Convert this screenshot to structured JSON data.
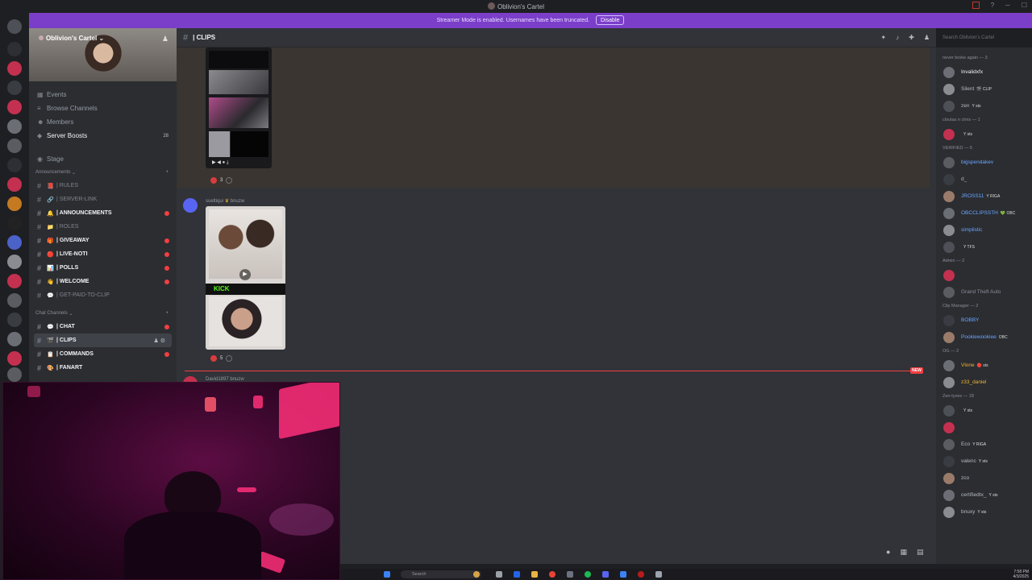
{
  "window": {
    "title": "Oblivion's Cartel"
  },
  "banner": {
    "text": "Streamer Mode is enabled. Usernames have been truncated.",
    "disable_label": "Disable"
  },
  "sidebar": {
    "server_name": "Oblivion's Cartel",
    "nav": [
      {
        "label": "Events",
        "icon": "calendar-icon"
      },
      {
        "label": "Browse Channels",
        "icon": "browse-icon"
      },
      {
        "label": "Members",
        "icon": "members-icon"
      },
      {
        "label": "Server Boosts",
        "icon": "boost-icon",
        "count": "28"
      },
      {
        "label": "Stage",
        "icon": "stage-icon"
      }
    ],
    "categories": [
      {
        "name": "Announcements",
        "channels": [
          {
            "label": "| RULES",
            "emoji": "📕",
            "unread": false
          },
          {
            "label": "| SERVER-LINK",
            "emoji": "🔗",
            "unread": false
          },
          {
            "label": "| ANNOUNCEMENTS",
            "emoji": "🔔",
            "unread": true
          },
          {
            "label": "| ROLES",
            "emoji": "📁",
            "unread": false
          },
          {
            "label": "| GIVEAWAY",
            "emoji": "🎁",
            "unread": true
          },
          {
            "label": "| LIVE-NOTI",
            "emoji": "🔴",
            "unread": true
          },
          {
            "label": "| POLLS",
            "emoji": "📊",
            "unread": true
          },
          {
            "label": "| WELCOME",
            "emoji": "👋",
            "unread": true
          },
          {
            "label": "| GET-PAID-TO-CLIP",
            "emoji": "💬",
            "unread": false
          }
        ]
      },
      {
        "name": "Chat Channels",
        "channels": [
          {
            "label": "| CHAT",
            "emoji": "💬",
            "unread": true
          },
          {
            "label": "| CLIPS",
            "emoji": "🎬",
            "unread": true,
            "active": true
          },
          {
            "label": "| COMMANDS",
            "emoji": "📋",
            "unread": true
          },
          {
            "label": "| FANART",
            "emoji": "🎨",
            "unread": true
          }
        ]
      }
    ]
  },
  "header": {
    "channel": "| CLIPS",
    "search_placeholder": "Search Oblivion's Cartel"
  },
  "messages": [
    {
      "reaction_count": "3"
    },
    {
      "author": "sueltiqui",
      "tag": "bnuzw",
      "reaction_count": "5",
      "kick_label": "KICK"
    },
    {
      "author": "David1897",
      "tag": "bnuzw"
    }
  ],
  "new_marker": "NEW",
  "members": {
    "groups": [
      {
        "name": "never broke again — 3",
        "items": [
          {
            "name": "Invalidxfx",
            "color": "#f2f3f5",
            "tag": ""
          },
          {
            "name": "Silent",
            "color": "#b5bac1",
            "tag": "🎬 CLIP"
          },
          {
            "name": "zen",
            "color": "#b5bac1",
            "tag": "Y sts"
          }
        ]
      },
      {
        "name": "cloutas n chris — 1",
        "items": [
          {
            "name": "",
            "color": "#b5bac1",
            "tag": "Y sts"
          }
        ]
      },
      {
        "name": "VERIFIED — 5",
        "items": [
          {
            "name": "bigspendakev",
            "color": "#6aa5ff",
            "tag": ""
          },
          {
            "name": "d_",
            "color": "#b5bac1",
            "tag": ""
          },
          {
            "name": "JROSS11",
            "color": "#6aa5ff",
            "tag": "Y RIGA"
          },
          {
            "name": "OBCCLIPSSTH",
            "color": "#6aa5ff",
            "tag": "💚 OBC"
          },
          {
            "name": "simplistic",
            "color": "#6aa5ff",
            "tag": ""
          },
          {
            "name": "",
            "color": "#b5bac1",
            "tag": "Y TFS"
          }
        ]
      },
      {
        "name": "Admin — 2",
        "items": [
          {
            "name": "",
            "color": "#b5bac1",
            "tag": ""
          },
          {
            "name": "Grand Theft Auto",
            "color": "#8a8e96",
            "tag": ""
          }
        ]
      },
      {
        "name": "Clip Manager — 2",
        "items": [
          {
            "name": "BOBBY",
            "color": "#6aa5ff",
            "tag": ""
          },
          {
            "name": "Pookiewookiee",
            "color": "#6aa5ff",
            "tag": "OBC"
          }
        ]
      },
      {
        "name": "OG — 2",
        "items": [
          {
            "name": "Vlone",
            "color": "#f0b232",
            "tag": "🔴 sts"
          },
          {
            "name": "z33_daniel",
            "color": "#f0b232",
            "tag": ""
          }
        ]
      },
      {
        "name": "Zen-tyves — 18",
        "items": [
          {
            "name": "",
            "color": "#b5bac1",
            "tag": "Y sts"
          },
          {
            "name": "",
            "color": "#b5bac1",
            "tag": ""
          },
          {
            "name": "Eco",
            "color": "#b5bac1",
            "tag": "Y RIGA"
          },
          {
            "name": "valenc",
            "color": "#b5bac1",
            "tag": "Y sts"
          },
          {
            "name": "zco",
            "color": "#b5bac1",
            "tag": ""
          },
          {
            "name": "certifiedtx_",
            "color": "#b5bac1",
            "tag": "Y sts"
          },
          {
            "name": "bnuxy",
            "color": "#b5bac1",
            "tag": "Y sts"
          }
        ]
      }
    ]
  },
  "taskbar": {
    "search_label": "Search",
    "time": "7:58 PM",
    "date": "4/3/2025"
  },
  "colors": {
    "accent": "#5865f2",
    "banner": "#7b3ec9",
    "unread": "#f23f43"
  }
}
